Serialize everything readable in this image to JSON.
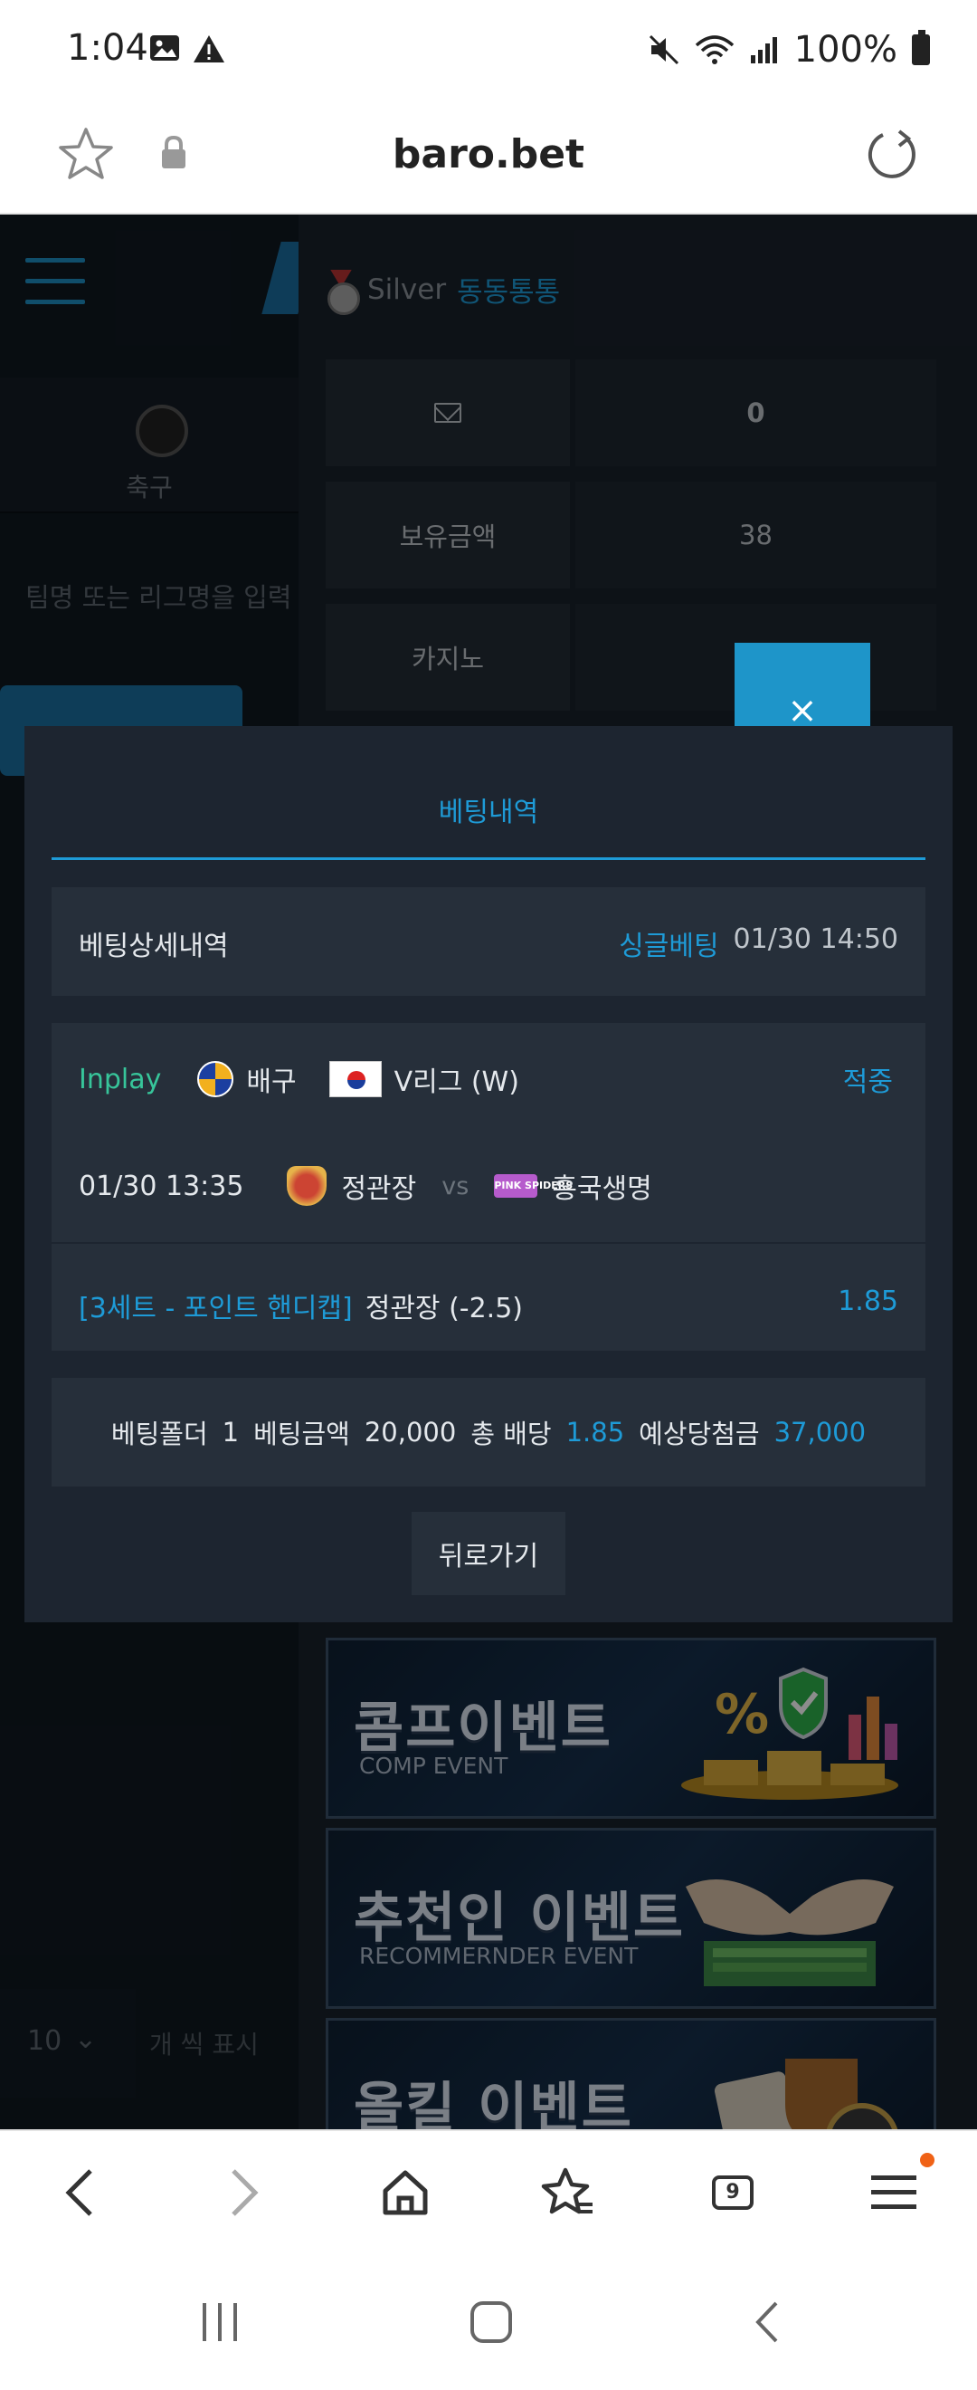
{
  "status_bar": {
    "time": "1:04",
    "battery": "100%"
  },
  "browser": {
    "domain": "baro.bet",
    "tab_count": "9"
  },
  "site": {
    "left": {
      "sport_label": "축구",
      "search_placeholder": "팀명 또는 리그명을 입력",
      "page_size_value": "10",
      "page_size_suffix": "개 씩 표시"
    },
    "user": {
      "grade": "Silver",
      "name": "동동통통"
    },
    "info_rows": [
      {
        "key_icon": "mail-icon",
        "value": "0"
      },
      {
        "key": "보유금액",
        "value": "38"
      },
      {
        "key": "카지노",
        "value": ""
      }
    ],
    "banners": [
      {
        "title": "콤프이벤트",
        "subtitle": "COMP EVENT"
      },
      {
        "title": "추천인 이벤트",
        "subtitle": "RECOMMERNDER EVENT"
      },
      {
        "title": "올킬 이벤트",
        "subtitle": ""
      }
    ]
  },
  "modal": {
    "close_label": "×",
    "tab_title": "베팅내역",
    "detail_label": "베팅상세내역",
    "bet_type": "싱글베팅",
    "bet_datetime": "01/30 14:50",
    "match": {
      "status": "Inplay",
      "sport": "배구",
      "league": "V리그 (W)",
      "result": "적중",
      "datetime": "01/30 13:35",
      "home": "정관장",
      "vs": "vs",
      "away": "흥국생명",
      "away_logo_text": "PINK SPIDERS",
      "market": "[3세트 - 포인트 핸디캡]",
      "pick": "정관장 (-2.5)",
      "odds": "1.85"
    },
    "summary": {
      "folder_label": "베팅폴더",
      "folder_value": "1",
      "amount_label": "베팅금액",
      "amount_value": "20,000",
      "total_odds_label": "총 배당",
      "total_odds_value": "1.85",
      "expected_label": "예상당첨금",
      "expected_value": "37,000"
    },
    "back_label": "뒤로가기"
  },
  "colors": {
    "accent": "#1e9bd7",
    "inplay": "#37c59a",
    "modal_bg": "#1d2530",
    "close_bg": "#1e95c9"
  }
}
